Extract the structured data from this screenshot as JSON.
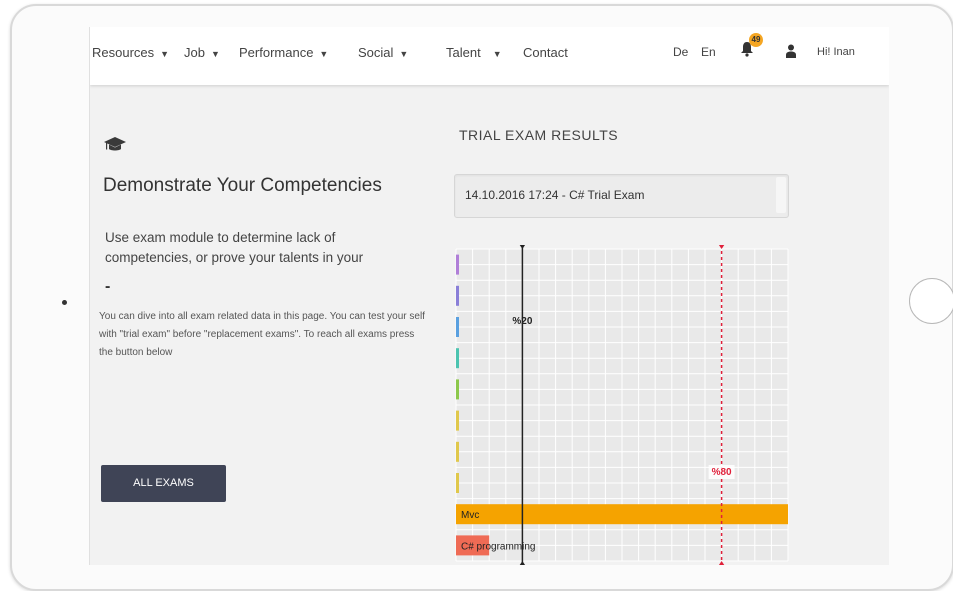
{
  "nav": {
    "items": [
      {
        "label": "Resources",
        "dropdown": true
      },
      {
        "label": "Job",
        "dropdown": true
      },
      {
        "label": "Performance",
        "dropdown": true
      },
      {
        "label": "Social",
        "dropdown": true
      },
      {
        "label": "Talent",
        "dropdown": true
      },
      {
        "label": "Contact",
        "dropdown": false
      }
    ],
    "languages": [
      "De",
      "En"
    ],
    "notification_count": "49",
    "user_greeting": "Hi! Inan"
  },
  "left": {
    "title": "Demonstrate Your Competencies",
    "subtitle": "Use exam module to determine lack of competencies, or prove your talents in your",
    "dash": "-",
    "description": "You can dive into all exam related data in this page. You can test your self with \"trial exam\" before \"replacement exams\". To reach all exams press the button below",
    "button_label": "ALL EXAMS"
  },
  "results": {
    "title": "TRIAL EXAM RESULTS",
    "selected_exam": "14.10.2016 17:24 - C# Trial Exam"
  },
  "chart_data": {
    "type": "bar",
    "orientation": "horizontal",
    "xlim": [
      0,
      100
    ],
    "xticks": [
      0,
      10,
      20,
      30,
      40,
      50,
      60,
      70,
      80,
      90,
      100
    ],
    "categories": [
      "",
      "",
      "",
      "",
      "",
      "",
      "",
      "",
      "Mvc",
      "C# programming"
    ],
    "values": [
      0,
      0,
      0,
      0,
      0,
      0,
      0,
      0,
      100,
      10
    ],
    "colors": [
      "#b07fd8",
      "#8a7fd8",
      "#5aa0e0",
      "#4cc4b0",
      "#8cc84b",
      "#e0c84b",
      "#e0c84b",
      "#e0c84b",
      "#f5a300",
      "#ef6b55"
    ],
    "reference_lines": [
      {
        "value": 20,
        "label": "%20",
        "color": "#222222",
        "style": "solid"
      },
      {
        "value": 80,
        "label": "%80",
        "color": "#e0203a",
        "style": "dashed"
      }
    ],
    "grid": true
  }
}
